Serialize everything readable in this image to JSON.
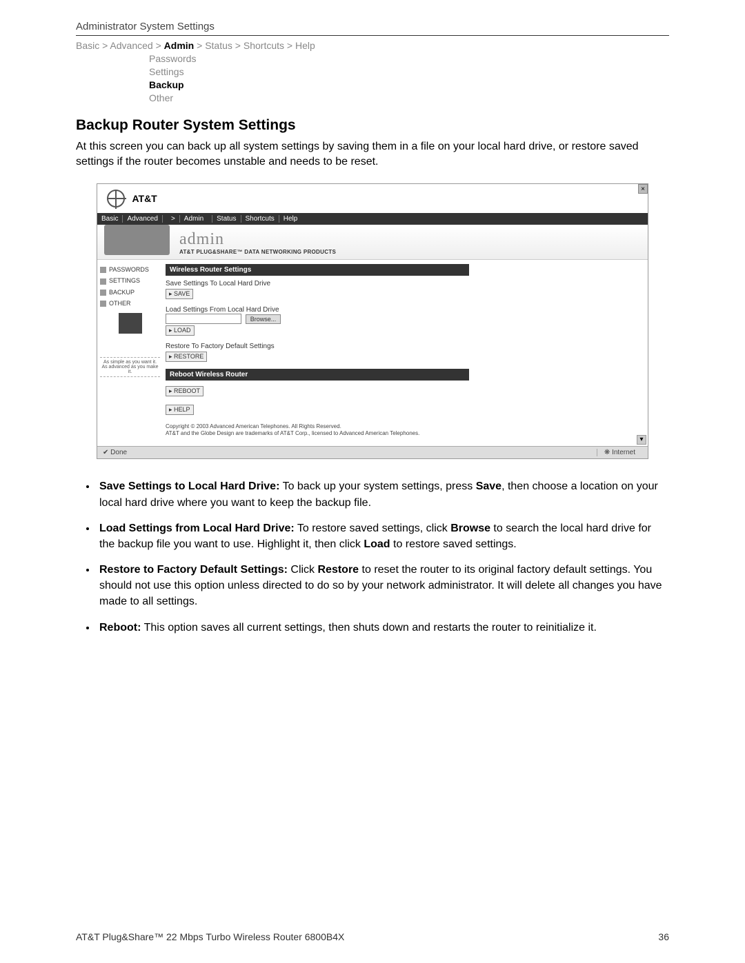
{
  "header": {
    "title": "Administrator System Settings"
  },
  "breadcrumb": {
    "basic": "Basic",
    "advanced": "Advanced",
    "admin": "Admin",
    "status": "Status",
    "shortcuts": "Shortcuts",
    "help": "Help",
    "sep": " > "
  },
  "submenu": {
    "passwords": "Passwords",
    "settings": "Settings",
    "backup": "Backup",
    "other": "Other"
  },
  "section": {
    "heading": "Backup Router System Settings",
    "intro": "At this screen you can back up all system settings by saving them in a file on your local hard drive, or restore saved settings if the router becomes unstable and needs to be reset."
  },
  "screenshot": {
    "brand": "AT&T",
    "nav": {
      "basic": "Basic",
      "advanced": "Advanced",
      "adminprefix": "> ",
      "admin": "Admin",
      "status": "Status",
      "shortcuts": "Shortcuts",
      "help": "Help"
    },
    "banner": {
      "title": "admin",
      "tag": "AT&T PLUG&SHARE™ DATA NETWORKING PRODUCTS"
    },
    "left": {
      "items": [
        "PASSWORDS",
        "SETTINGS",
        "BACKUP",
        "OTHER"
      ],
      "slogan1": "As simple as you want it.",
      "slogan2": "As advanced as you make it."
    },
    "panels": {
      "bar1": "Wireless Router Settings",
      "save_label": "Save Settings To Local Hard Drive",
      "save_btn": "▸ SAVE",
      "load_label": "Load Settings From Local Hard Drive",
      "browse_btn": "Browse...",
      "load_btn": "▸ LOAD",
      "restore_label": "Restore To Factory Default Settings",
      "restore_btn": "▸ RESTORE",
      "bar2": "Reboot Wireless Router",
      "reboot_btn": "▸ REBOOT",
      "help_btn": "▸ HELP"
    },
    "copyright1": "Copyright © 2003 Advanced American Telephones. All Rights Reserved.",
    "copyright2": "AT&T and the Globe Design are trademarks of AT&T Corp., licensed to Advanced American Telephones.",
    "status_done": "Done",
    "status_net": "Internet"
  },
  "bullets": {
    "b1_bold": "Save Settings to Local Hard Drive:",
    "b1_text_a": " To back up your system settings, press ",
    "b1_save": "Save",
    "b1_text_b": ", then choose a location on your local hard drive where you want to keep the backup file.",
    "b2_bold": "Load Settings from Local Hard Drive:",
    "b2_text_a": " To restore saved settings, click ",
    "b2_browse": "Browse",
    "b2_text_b": " to search the local hard drive for the backup file you want to use. Highlight it, then click ",
    "b2_load": "Load",
    "b2_text_c": " to restore saved settings.",
    "b3_bold": "Restore to Factory Default Settings:",
    "b3_text_a": " Click ",
    "b3_restore": "Restore",
    "b3_text_b": " to reset the router to its original factory default settings. You should not use this option unless directed to do so by your network administrator. It will delete all changes you have made to all settings.",
    "b4_bold": "Reboot:",
    "b4_text": " This option saves all current settings, then shuts down and restarts the router to reinitialize it."
  },
  "footer": {
    "left": "AT&T Plug&Share™ 22 Mbps Turbo Wireless Router 6800B4X",
    "right": "36"
  }
}
